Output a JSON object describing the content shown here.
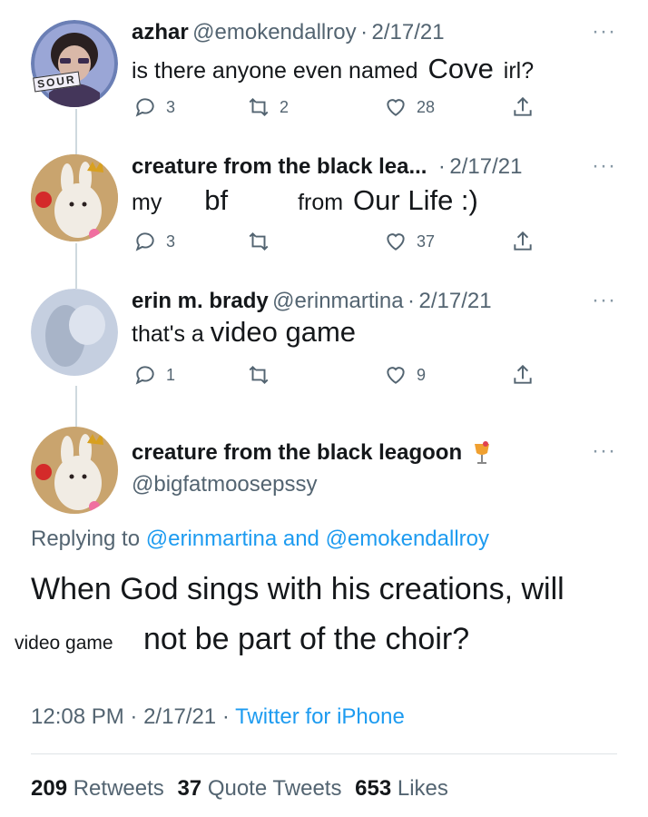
{
  "tweets": [
    {
      "name": "azhar",
      "handle": "@emokendallroy",
      "date": "2/17/21",
      "text_a": "is there anyone even named",
      "text_b": "Cove",
      "text_c": "irl?",
      "replies": "3",
      "retweets": "2",
      "likes": "28",
      "avatar_badge": "SOUR"
    },
    {
      "name": "creature from the black lea...",
      "date": "2/17/21",
      "text_a": "my",
      "text_b": "bf",
      "text_c": "from",
      "text_d": "Our Life :)",
      "replies": "3",
      "retweets": "",
      "likes": "37"
    },
    {
      "name": "erin m. brady",
      "handle": "@erinmartina",
      "date": "2/17/21",
      "text_a": "that's a",
      "text_b": "video game",
      "replies": "1",
      "retweets": "",
      "likes": "9"
    }
  ],
  "main_tweet": {
    "name": "creature from the black leagoon",
    "handle": "@bigfatmoosepssy",
    "replying_prefix": "Replying to",
    "replying_user1": "@erinmartina",
    "replying_and": "and",
    "replying_user2": "@emokendallroy",
    "line1": "When God sings with his creations, will",
    "overlay_text": "video game",
    "line2": "not be part of the choir?",
    "time": "12:08 PM",
    "date": "2/17/21",
    "source": "Twitter for iPhone",
    "retweets_count": "209",
    "retweets_label": "Retweets",
    "quotes_count": "37",
    "quotes_label": "Quote Tweets",
    "likes_count": "653",
    "likes_label": "Likes"
  },
  "ui": {
    "dot": "·",
    "more": "···"
  },
  "colors": {
    "accent": "#1d9bf0",
    "secondary_text": "#536471",
    "primary_text": "#14171a",
    "thread_line": "#cfd9de"
  },
  "icons": [
    "reply-icon",
    "retweet-icon",
    "like-icon",
    "share-icon",
    "more-icon",
    "cocktail-emoji-icon"
  ]
}
